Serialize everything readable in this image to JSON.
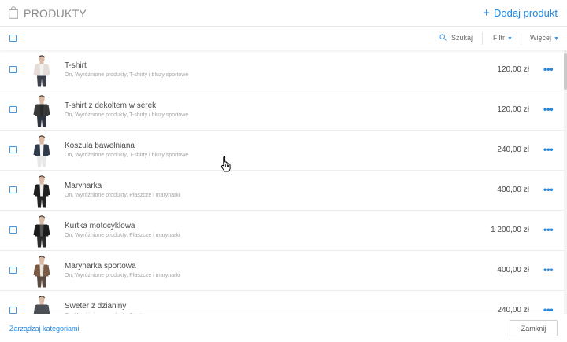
{
  "header": {
    "title": "PRODUKTY",
    "add_label": "Dodaj produkt"
  },
  "toolbar": {
    "search_label": "Szukaj",
    "filter_label": "Filtr",
    "more_label": "Więcej"
  },
  "products": [
    {
      "name": "T-shirt",
      "categories": "On, Wyróżnione produkty, T-shirty i bluzy sportowe",
      "price": "120,00 zł",
      "shirt": "#f2f2f2",
      "jacket": "#e6dcd7",
      "pants": "#3a3f4a"
    },
    {
      "name": "T-shirt z dekoltem w serek",
      "categories": "On, Wyróżnione produkty, T-shirty i bluzy sportowe",
      "price": "120,00 zł",
      "shirt": "#2b2b2b",
      "jacket": "#3a3a3a",
      "pants": "#2f3540"
    },
    {
      "name": "Koszula bawełniana",
      "categories": "On, Wyróżnione produkty, T-shirty i bluzy sportowe",
      "price": "240,00 zł",
      "shirt": "#f5f5f5",
      "jacket": "#2f3a4a",
      "pants": "#e8e8e8"
    },
    {
      "name": "Marynarka",
      "categories": "On, Wyróżnione produkty, Płaszcze i marynarki",
      "price": "400,00 zł",
      "shirt": "#ececec",
      "jacket": "#1f1f1f",
      "pants": "#222222"
    },
    {
      "name": "Kurtka motocyklowa",
      "categories": "On, Wyróżnione produkty, Płaszcze i marynarki",
      "price": "1 200,00 zł",
      "shirt": "#555555",
      "jacket": "#1c1c1c",
      "pants": "#2a2a2a"
    },
    {
      "name": "Marynarka sportowa",
      "categories": "On, Wyróżnione produkty, Płaszcze i marynarki",
      "price": "400,00 zł",
      "shirt": "#e9e4dc",
      "jacket": "#7a5a45",
      "pants": "#5a4a3f"
    },
    {
      "name": "Sweter z dzianiny",
      "categories": "On, Wyróżnione produkty, Swetry",
      "price": "240,00 zł",
      "shirt": "#4a4f55",
      "jacket": "#4a4f55",
      "pants": "#2c2c2c"
    }
  ],
  "footer": {
    "manage_label": "Zarządzaj kategoriami",
    "close_label": "Zamknij"
  },
  "colors": {
    "accent": "#1e88e5",
    "border": "#e6e6e6",
    "muted_text": "#a5a5a5"
  }
}
